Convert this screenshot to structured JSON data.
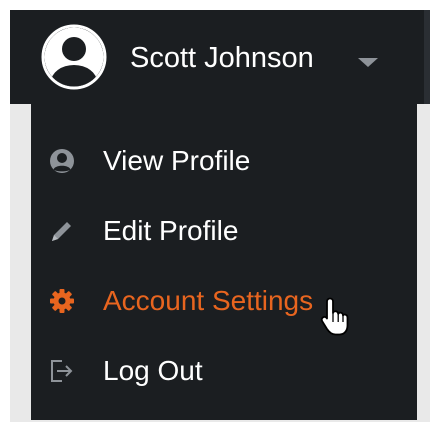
{
  "user": {
    "name": "Scott Johnson",
    "avatar_icon": "user-circle-icon",
    "dropdown_icon": "caret-down-icon"
  },
  "menu": {
    "items": [
      {
        "label": "View Profile",
        "icon": "user-circle-icon",
        "active": false
      },
      {
        "label": "Edit Profile",
        "icon": "pencil-icon",
        "active": false
      },
      {
        "label": "Account Settings",
        "icon": "gear-icon",
        "active": true
      },
      {
        "label": "Log Out",
        "icon": "sign-out-icon",
        "active": false
      }
    ]
  },
  "colors": {
    "bar_background": "#1b1e21",
    "text": "#ffffff",
    "accent": "#e8651f",
    "muted_icon": "#8e9399",
    "page_background": "#e9e9e9"
  }
}
